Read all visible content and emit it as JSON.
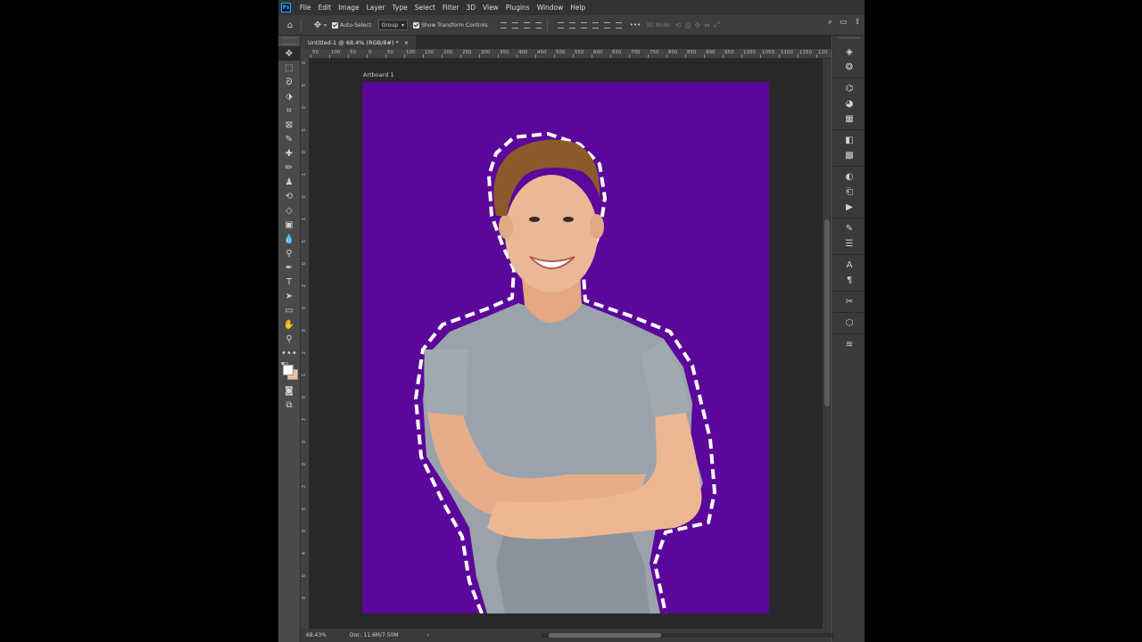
{
  "app": {
    "logo": "Ps"
  },
  "menu": [
    "File",
    "Edit",
    "Image",
    "Layer",
    "Type",
    "Select",
    "Filter",
    "3D",
    "View",
    "Plugins",
    "Window",
    "Help"
  ],
  "options_bar": {
    "auto_select_label": "Auto-Select:",
    "auto_select_value": "Group",
    "transform_label": "Show Transform Controls",
    "mode_3d_label": "3D Mode:",
    "more_label": "•••"
  },
  "document": {
    "tab_title": "Untitled-1 @ 68.4% (RGB/8#) *",
    "close_glyph": "×",
    "artboard_label": "Artboard 1",
    "artboard_color": "#5b079b",
    "outline_color": "#ffffff"
  },
  "ruler": {
    "top_labels": [
      "50",
      "100",
      "50",
      "0",
      "50",
      "100",
      "150",
      "200",
      "250",
      "300",
      "350",
      "400",
      "450",
      "500",
      "550",
      "600",
      "650",
      "700",
      "750",
      "800",
      "850",
      "900",
      "950",
      "1000",
      "1050",
      "1100",
      "1150",
      "120"
    ],
    "left_labels": [
      "0",
      "5",
      "0",
      "5",
      "0",
      "1",
      "0",
      "1",
      "5",
      "0",
      "2",
      "0",
      "0",
      "2",
      "5",
      "0",
      "3",
      "0",
      "0",
      "3",
      "5",
      "0",
      "4",
      "0",
      "0"
    ]
  },
  "status": {
    "zoom": "68.43%",
    "doc_size": "Doc: 11.6M/7.50M",
    "arrow": "›"
  },
  "swatches": {
    "foreground": "#ffffff",
    "background": "#ecc3a8"
  }
}
